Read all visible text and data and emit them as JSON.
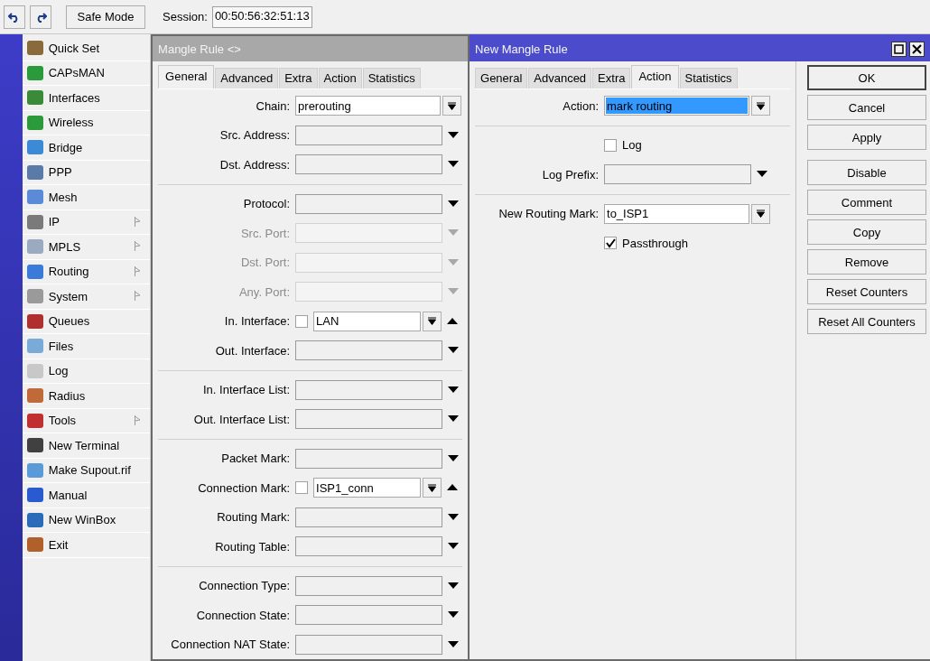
{
  "toolbar": {
    "safe_mode": "Safe Mode",
    "session_label": "Session:",
    "session_value": "00:50:56:32:51:13"
  },
  "menu": {
    "items": [
      {
        "label": "Quick Set",
        "submenu": false
      },
      {
        "label": "CAPsMAN",
        "submenu": false
      },
      {
        "label": "Interfaces",
        "submenu": false
      },
      {
        "label": "Wireless",
        "submenu": false
      },
      {
        "label": "Bridge",
        "submenu": false
      },
      {
        "label": "PPP",
        "submenu": false
      },
      {
        "label": "Mesh",
        "submenu": false
      },
      {
        "label": "IP",
        "submenu": true
      },
      {
        "label": "MPLS",
        "submenu": true
      },
      {
        "label": "Routing",
        "submenu": true
      },
      {
        "label": "System",
        "submenu": true
      },
      {
        "label": "Queues",
        "submenu": false
      },
      {
        "label": "Files",
        "submenu": false
      },
      {
        "label": "Log",
        "submenu": false
      },
      {
        "label": "Radius",
        "submenu": false
      },
      {
        "label": "Tools",
        "submenu": true
      },
      {
        "label": "New Terminal",
        "submenu": false
      },
      {
        "label": "Make Supout.rif",
        "submenu": false
      },
      {
        "label": "Manual",
        "submenu": false
      },
      {
        "label": "New WinBox",
        "submenu": false
      },
      {
        "label": "Exit",
        "submenu": false
      }
    ]
  },
  "mangle_window": {
    "title": "Mangle Rule <>",
    "active": false,
    "tabs": [
      {
        "label": "General",
        "selected": true
      },
      {
        "label": "Advanced",
        "selected": false
      },
      {
        "label": "Extra",
        "selected": false
      },
      {
        "label": "Action",
        "selected": false
      },
      {
        "label": "Statistics",
        "selected": false
      }
    ],
    "sections": [
      [
        {
          "kind": "combo",
          "label": "Chain:",
          "value": "prerouting",
          "highlighted": false
        },
        {
          "kind": "dropdown",
          "label": "Src. Address:",
          "disabled": false
        },
        {
          "kind": "dropdown",
          "label": "Dst. Address:",
          "disabled": false
        }
      ],
      [
        {
          "kind": "dropdown",
          "label": "Protocol:",
          "disabled": false
        },
        {
          "kind": "dropdown",
          "label": "Src. Port:",
          "disabled": true
        },
        {
          "kind": "dropdown",
          "label": "Dst. Port:",
          "disabled": true
        },
        {
          "kind": "dropdown",
          "label": "Any. Port:",
          "disabled": true
        },
        {
          "kind": "combo-check",
          "label": "In. Interface:",
          "value": "LAN",
          "checked": false
        },
        {
          "kind": "dropdown",
          "label": "Out. Interface:",
          "disabled": false
        }
      ],
      [
        {
          "kind": "dropdown",
          "label": "In. Interface List:",
          "disabled": false
        },
        {
          "kind": "dropdown",
          "label": "Out. Interface List:",
          "disabled": false
        }
      ],
      [
        {
          "kind": "dropdown",
          "label": "Packet Mark:",
          "disabled": false
        },
        {
          "kind": "combo-check",
          "label": "Connection Mark:",
          "value": "ISP1_conn",
          "checked": false
        },
        {
          "kind": "dropdown",
          "label": "Routing Mark:",
          "disabled": false
        },
        {
          "kind": "dropdown",
          "label": "Routing Table:",
          "disabled": false
        }
      ],
      [
        {
          "kind": "dropdown",
          "label": "Connection Type:",
          "disabled": false
        },
        {
          "kind": "dropdown",
          "label": "Connection State:",
          "disabled": false
        },
        {
          "kind": "dropdown",
          "label": "Connection NAT State:",
          "disabled": false
        }
      ]
    ]
  },
  "new_window": {
    "title": "New Mangle Rule",
    "active": true,
    "tabs": [
      {
        "label": "General",
        "selected": false
      },
      {
        "label": "Advanced",
        "selected": false
      },
      {
        "label": "Extra",
        "selected": false
      },
      {
        "label": "Action",
        "selected": true
      },
      {
        "label": "Statistics",
        "selected": false
      }
    ],
    "sections": [
      [
        {
          "kind": "combo",
          "label": "Action:",
          "value": "mark routing",
          "highlighted": true
        }
      ],
      [
        {
          "kind": "checkbox",
          "label": "Log",
          "checked": false
        },
        {
          "kind": "dropdown",
          "label": "Log Prefix:",
          "disabled": false
        }
      ],
      [
        {
          "kind": "combo",
          "label": "New Routing Mark:",
          "value": "to_ISP1",
          "highlighted": false
        },
        {
          "kind": "checkbox",
          "label": "Passthrough",
          "checked": true
        }
      ]
    ],
    "buttons": [
      "OK",
      "Cancel",
      "Apply",
      "Disable",
      "Comment",
      "Copy",
      "Remove",
      "Reset Counters",
      "Reset All Counters"
    ]
  }
}
